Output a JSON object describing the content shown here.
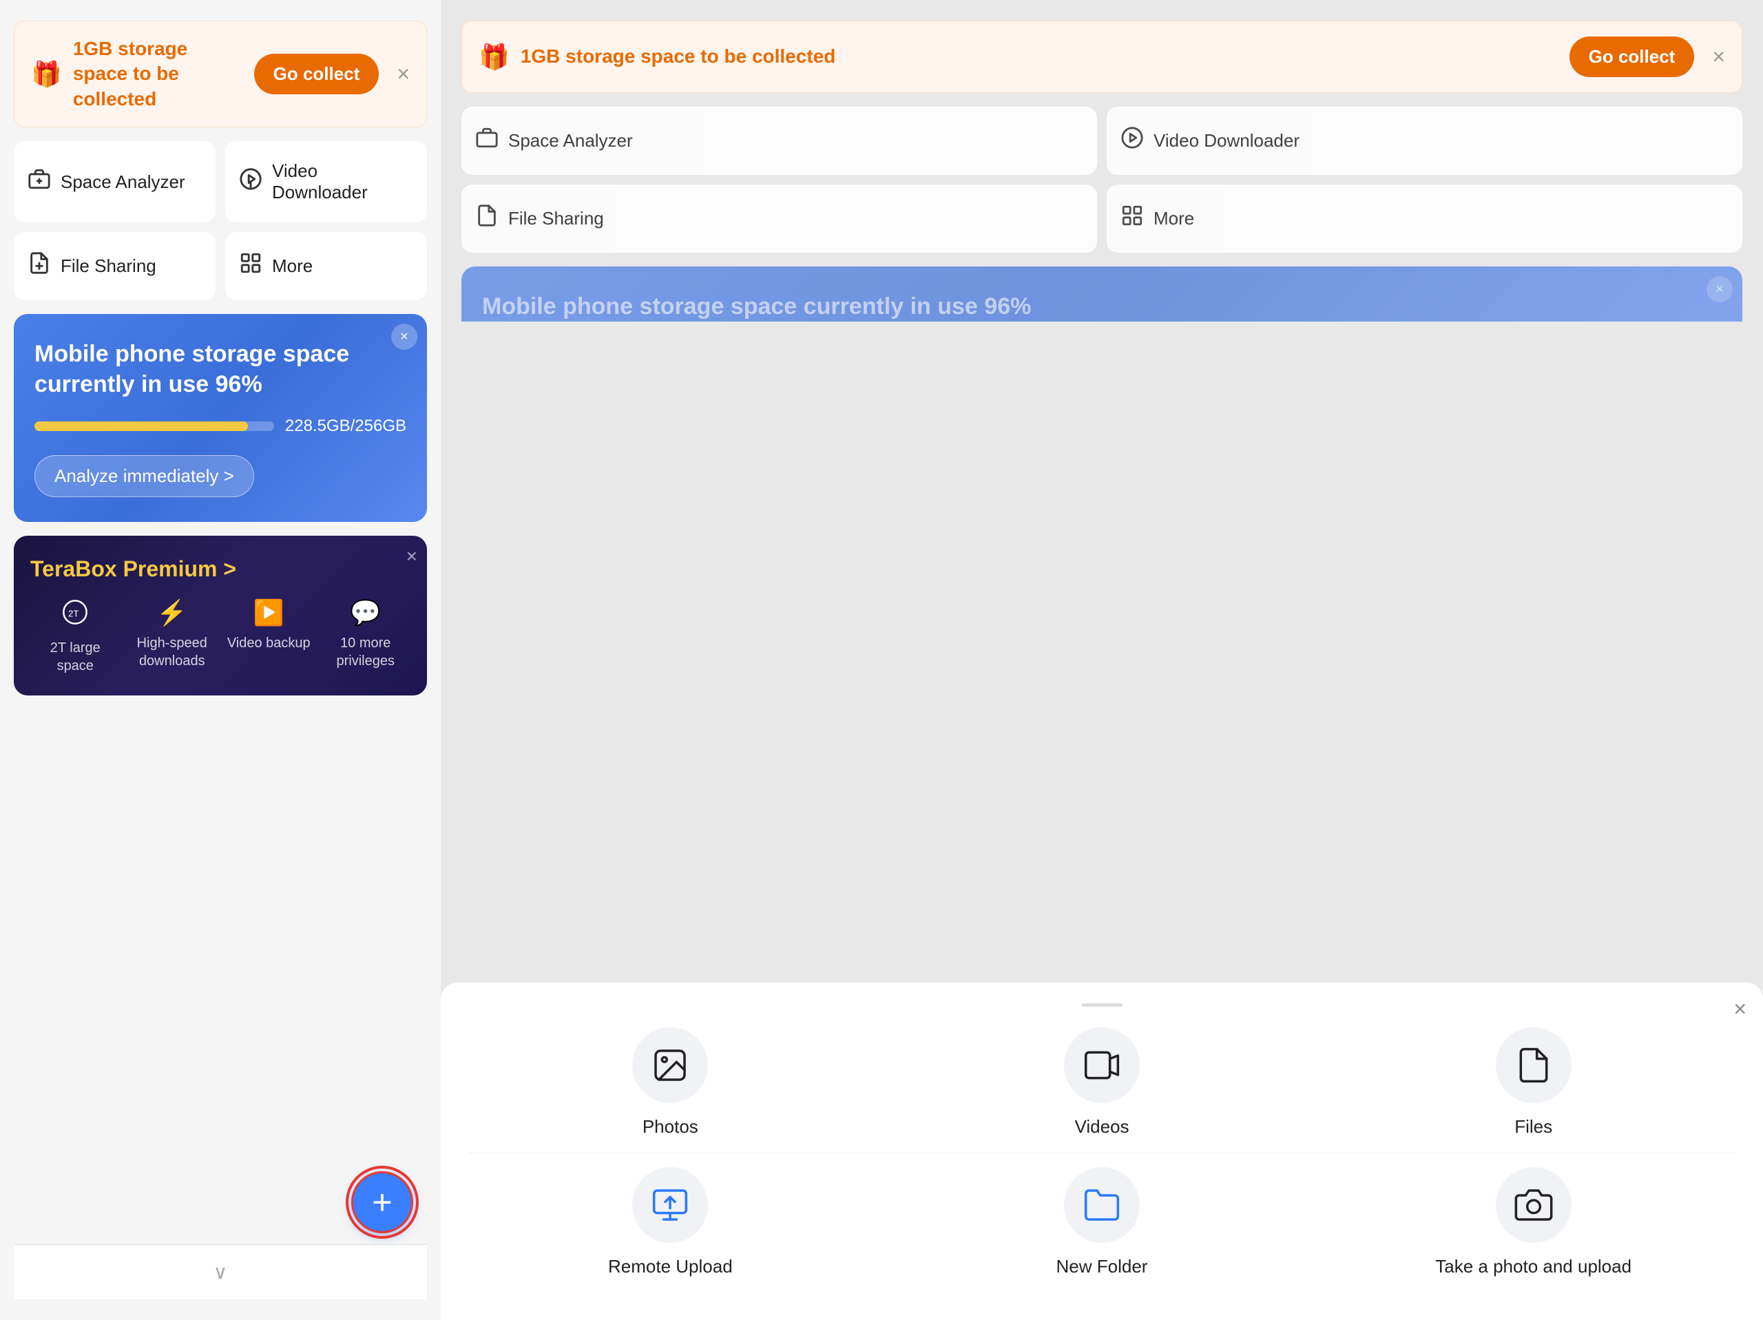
{
  "left": {
    "promo": {
      "icon": "🎁",
      "text": "1GB storage space to be collected",
      "button_label": "Go collect",
      "close": "×"
    },
    "tools": [
      {
        "id": "space-analyzer",
        "icon": "🗄️",
        "label": "Space Analyzer"
      },
      {
        "id": "video-downloader",
        "icon": "⏬",
        "label": "Video Downloader"
      },
      {
        "id": "file-sharing",
        "icon": "📤",
        "label": "File Sharing"
      },
      {
        "id": "more",
        "icon": "⊞",
        "label": "More"
      }
    ],
    "storage": {
      "close": "×",
      "title": "Mobile phone storage space currently in use 96%",
      "progress_pct": 89,
      "progress_label": "228.5GB/256GB",
      "analyze_label": "Analyze immediately >"
    },
    "premium": {
      "close": "×",
      "title": "TeraBox Premium >",
      "features": [
        {
          "icon": "☁️",
          "label": "2T large space"
        },
        {
          "icon": "⚡",
          "label": "High-speed downloads"
        },
        {
          "icon": "▶️",
          "label": "Video backup"
        },
        {
          "icon": "💬",
          "label": "10 more privileges"
        }
      ]
    },
    "fab": {
      "icon": "+"
    },
    "bottom_arrow": "∨"
  },
  "right": {
    "promo": {
      "icon": "🎁",
      "text": "1GB storage space to be collected",
      "button_label": "Go collect",
      "close": "×"
    },
    "tools": [
      {
        "id": "space-analyzer",
        "icon": "🗄️",
        "label": "Space Analyzer"
      },
      {
        "id": "video-downloader",
        "icon": "⏬",
        "label": "Video Downloader"
      },
      {
        "id": "file-sharing",
        "icon": "📤",
        "label": "File Sharing"
      },
      {
        "id": "more",
        "icon": "⊞",
        "label": "More"
      }
    ],
    "storage": {
      "close": "×",
      "title": "Mobile phone storage space currently in use 96%"
    },
    "modal": {
      "close": "×",
      "items_row1": [
        {
          "id": "photos",
          "icon": "🖼️",
          "label": "Photos"
        },
        {
          "id": "videos",
          "icon": "📹",
          "label": "Videos"
        },
        {
          "id": "files",
          "icon": "📄",
          "label": "Files"
        }
      ],
      "items_row2": [
        {
          "id": "remote-upload",
          "icon": "⬆️",
          "label": "Remote Upload"
        },
        {
          "id": "new-folder",
          "icon": "📁",
          "label": "New Folder"
        },
        {
          "id": "take-photo",
          "icon": "📷",
          "label": "Take a photo and upload"
        }
      ]
    }
  }
}
